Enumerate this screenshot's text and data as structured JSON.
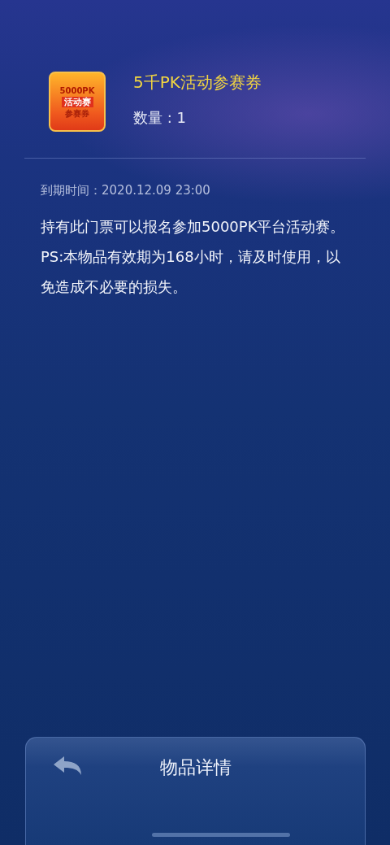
{
  "item": {
    "badge_lines": [
      "5000PK",
      "活动赛",
      "参赛券"
    ],
    "title": "5千PK活动参赛券",
    "quantity": "数量 : 1"
  },
  "expiry": "到期时间：2020.12.09 23:00",
  "description": "持有此门票可以报名参加5000PK平台活动赛。PS:本物品有效期为168小时，请及时使用，以免造成不必要的损失。",
  "bottom_bar": {
    "title": "物品详情"
  }
}
